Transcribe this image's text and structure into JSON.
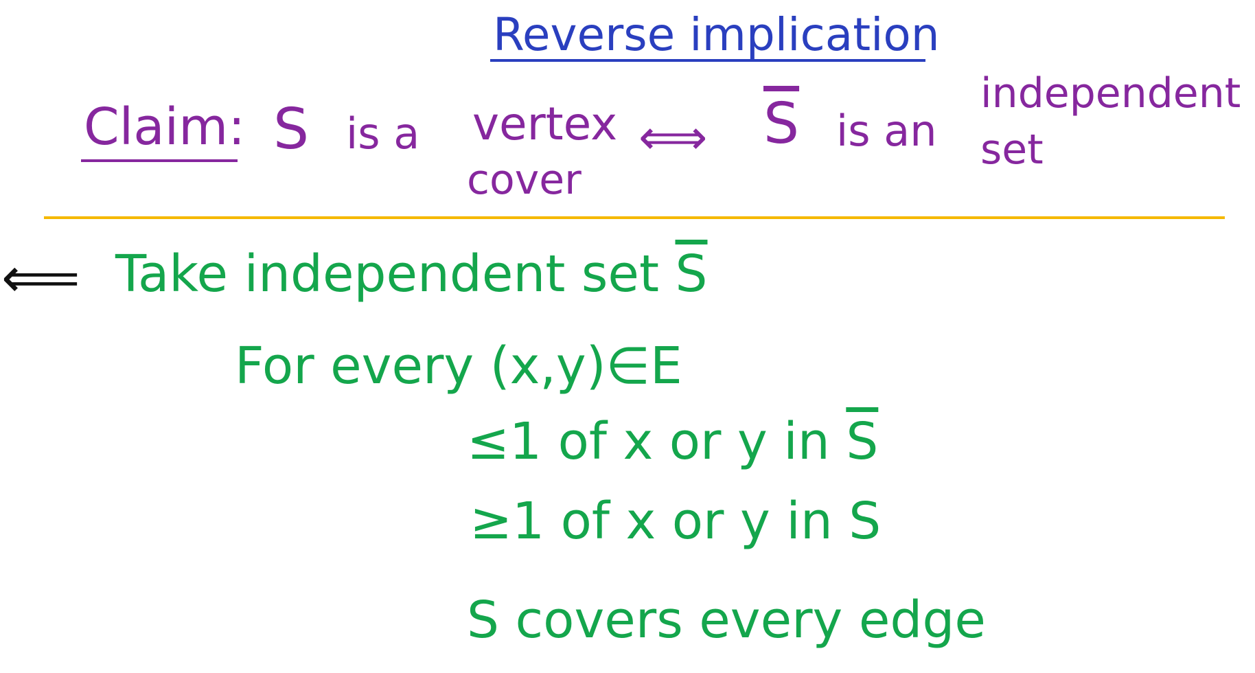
{
  "title": "Reverse implication",
  "claim": {
    "label": "Claim:",
    "s": "S",
    "is_a": "is a",
    "vertex": "vertex",
    "cover": "cover",
    "iff_symbol": "⟺",
    "s_bar": "S",
    "is_an": "is an",
    "independent": "independent",
    "set": "set"
  },
  "proof": {
    "direction_arrow": "⟸",
    "line1_text": "Take independent set",
    "line1_sbar": "S",
    "line2": "For every (x,y)∈E",
    "line3_text": "≤1 of x or y in",
    "line3_sbar": "S",
    "line4": "≥1 of x or y in S",
    "line5": "S covers every edge"
  },
  "colors": {
    "title": "#2a3fbf",
    "claim": "#86279e",
    "proof": "#14a64c",
    "divider": "#f5b800",
    "arrow": "#111111"
  }
}
